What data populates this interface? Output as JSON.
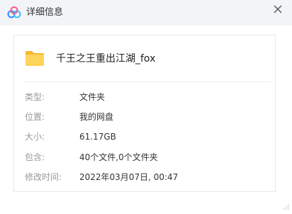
{
  "window": {
    "title": "详细信息",
    "close_icon": "close-icon",
    "app_icon": "baidu-netdisk-icon"
  },
  "file": {
    "icon": "folder-icon",
    "name": "千王之王重出江湖_fox"
  },
  "details": [
    {
      "label": "类型:",
      "value": "文件夹"
    },
    {
      "label": "位置:",
      "value": "我的网盘"
    },
    {
      "label": "大小:",
      "value": "61.17GB"
    },
    {
      "label": "包含:",
      "value": "40个文件,0个文件夹"
    },
    {
      "label": "修改时间:",
      "value": "2022年03月07日, 00:47"
    }
  ],
  "colors": {
    "titlebar_bg": "#f2f4f7",
    "folder_yellow": "#f8c93e",
    "label_gray": "#999999",
    "value_dark": "#333333"
  }
}
